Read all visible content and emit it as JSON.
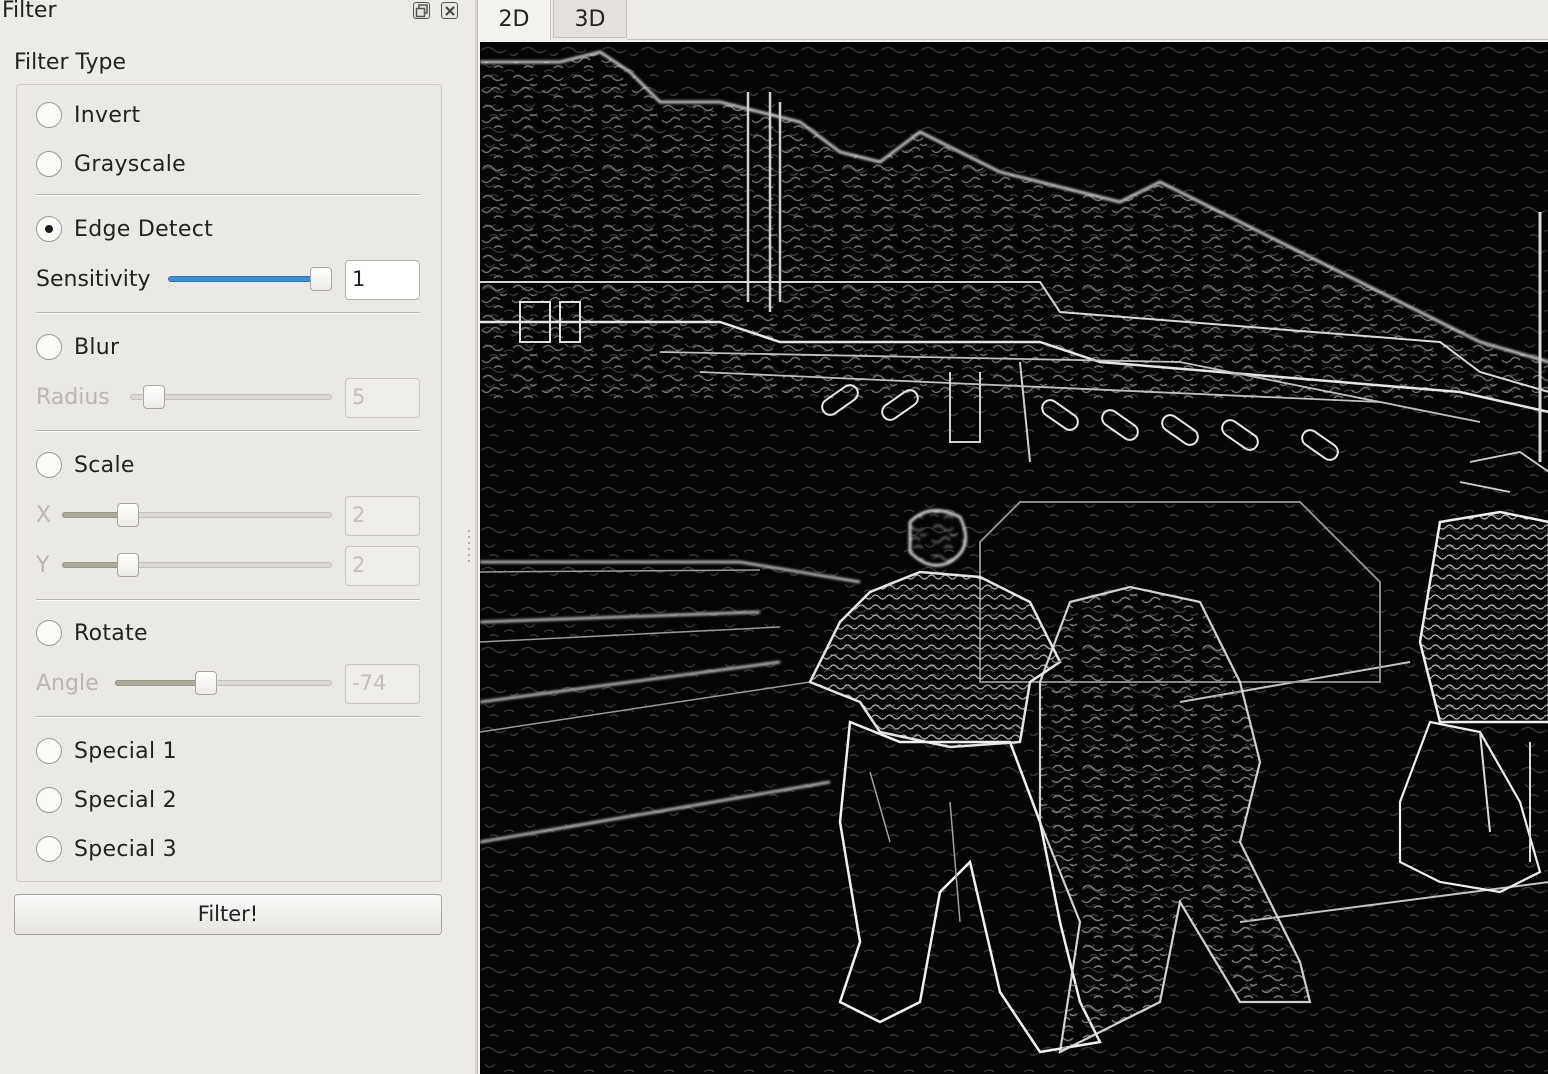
{
  "dock": {
    "title": "Filter",
    "float_icon": "float-icon",
    "close_icon": "close-icon"
  },
  "filter_type": {
    "title": "Filter Type",
    "options": {
      "invert": {
        "label": "Invert",
        "checked": false
      },
      "grayscale": {
        "label": "Grayscale",
        "checked": false
      },
      "edge_detect": {
        "label": "Edge Detect",
        "checked": true
      },
      "blur": {
        "label": "Blur",
        "checked": false
      },
      "scale": {
        "label": "Scale",
        "checked": false
      },
      "rotate": {
        "label": "Rotate",
        "checked": false
      },
      "special1": {
        "label": "Special 1",
        "checked": false
      },
      "special2": {
        "label": "Special 2",
        "checked": false
      },
      "special3": {
        "label": "Special 3",
        "checked": false
      }
    },
    "params": {
      "sensitivity": {
        "label": "Sensitivity",
        "value": "1",
        "slider_fraction": 1.0,
        "enabled": true
      },
      "radius": {
        "label": "Radius",
        "value": "5",
        "slider_fraction": 0.07,
        "enabled": false
      },
      "scale_x": {
        "label": "X",
        "value": "2",
        "slider_fraction": 0.22,
        "enabled": false
      },
      "scale_y": {
        "label": "Y",
        "value": "2",
        "slider_fraction": 0.22,
        "enabled": false
      },
      "angle": {
        "label": "Angle",
        "value": "-74",
        "slider_fraction": 0.41,
        "enabled": false
      }
    }
  },
  "filter_button": {
    "label": "Filter!"
  },
  "viewer": {
    "tabs": [
      {
        "label": "2D",
        "active": true
      },
      {
        "label": "3D",
        "active": false
      }
    ],
    "image_description_colors": {
      "background": "#050505",
      "edges": "#f0f0f0"
    }
  },
  "colors": {
    "slider_active": "#3b8fd6",
    "slider_inactive": "#aeab9c",
    "window_bg": "#edebe7"
  }
}
